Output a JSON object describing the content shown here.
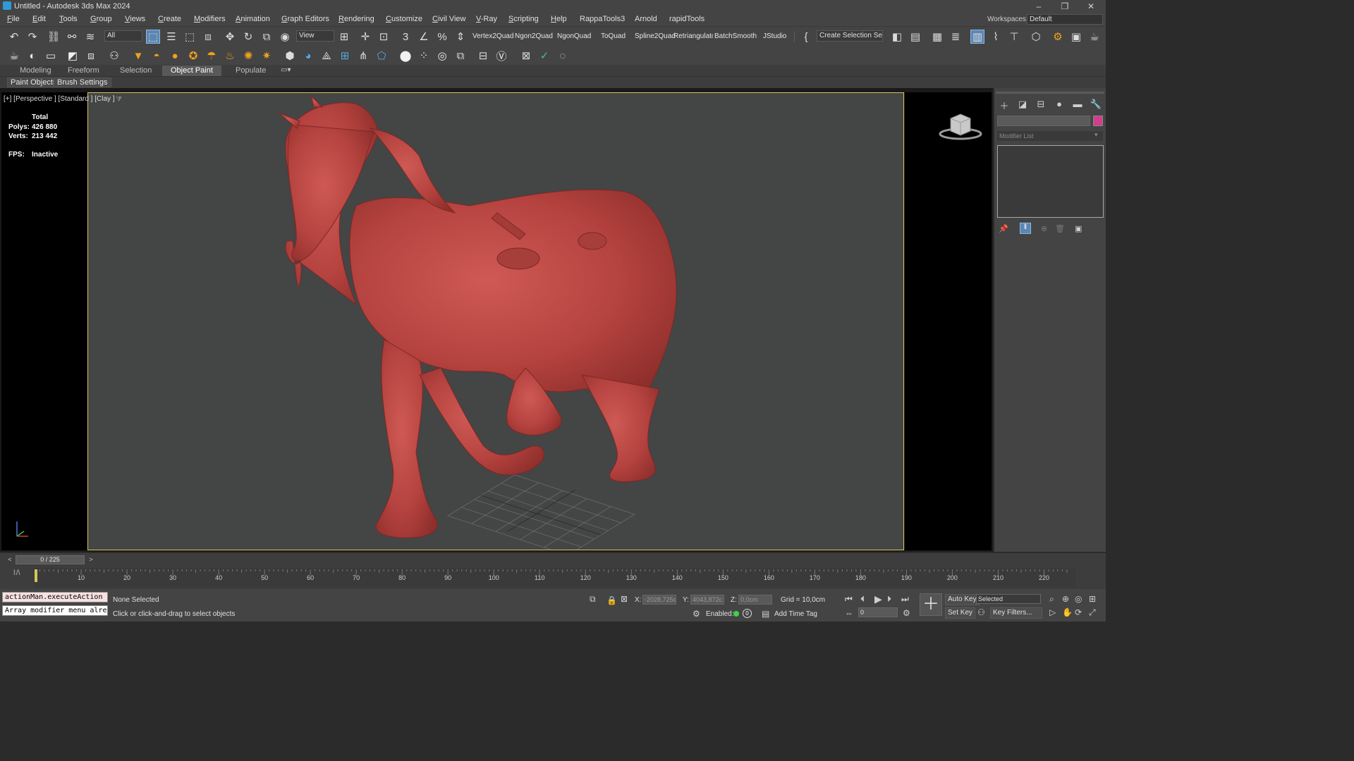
{
  "window": {
    "title": "Untitled - Autodesk 3ds Max 2024",
    "minimize": "–",
    "restore": "❐",
    "close": "✕"
  },
  "menu": [
    "File",
    "Edit",
    "Tools",
    "Group",
    "Views",
    "Create",
    "Modifiers",
    "Animation",
    "Graph Editors",
    "Rendering",
    "Customize",
    "Civil View",
    "V-Ray",
    "Scripting",
    "Help",
    "RappaTools3",
    "Arnold",
    "rapidTools"
  ],
  "workspace": {
    "label": "Workspaces:",
    "value": "Default"
  },
  "toolbar1": {
    "selection_filter": "All",
    "ref_coord": "View",
    "scripts": [
      "Vertex2Quad",
      "Ngon2Quad",
      "NgonQuad",
      "ToQuad",
      "Spline2Quad",
      "Retriangulator",
      "BatchSmooth",
      "JStudio"
    ],
    "named_selection": "Create Selection Se"
  },
  "ribbon": {
    "tabs": [
      "Modeling",
      "Freeform",
      "Selection",
      "Object Paint",
      "Populate"
    ],
    "active_tab": "Object Paint",
    "sub_buttons": [
      "Paint Objects",
      "Brush Settings"
    ]
  },
  "viewport": {
    "label": "[+] [Perspective ] [Standard ] [Clay ]",
    "stats": {
      "total_label": "Total",
      "polys_label": "Polys:",
      "polys_value": "426 880",
      "verts_label": "Verts:",
      "verts_value": "213 442",
      "fps_label": "FPS:",
      "fps_value": "Inactive"
    },
    "model_color": "#b5433f"
  },
  "command_panel": {
    "modifier_list": "Modifier List",
    "color_swatch": "#d03e8c"
  },
  "timeline": {
    "frame_display": "0 / 225",
    "ticks": [
      "10",
      "20",
      "30",
      "40",
      "50",
      "60",
      "70",
      "80",
      "90",
      "100",
      "110",
      "120",
      "130",
      "140",
      "150",
      "160",
      "170",
      "180",
      "190",
      "200",
      "210",
      "220"
    ]
  },
  "status": {
    "maxscript_line1": "actionMan.executeAction (",
    "maxscript_line2": "Array modifier menu alre:",
    "selection": "None Selected",
    "prompt": "Click or click-and-drag to select objects",
    "x_label": "X:",
    "x_value": "-2028,725c",
    "y_label": "Y:",
    "y_value": "4043,872c",
    "z_label": "Z:",
    "z_value": "0,0cm",
    "grid": "Grid = 10,0cm",
    "enabled_label": "Enabled:",
    "add_time_tag": "Add Time Tag",
    "auto_key": "Auto Key",
    "set_key": "Set Key",
    "selected_set": "Selected",
    "key_filters": "Key Filters...",
    "frame_value": "0"
  }
}
